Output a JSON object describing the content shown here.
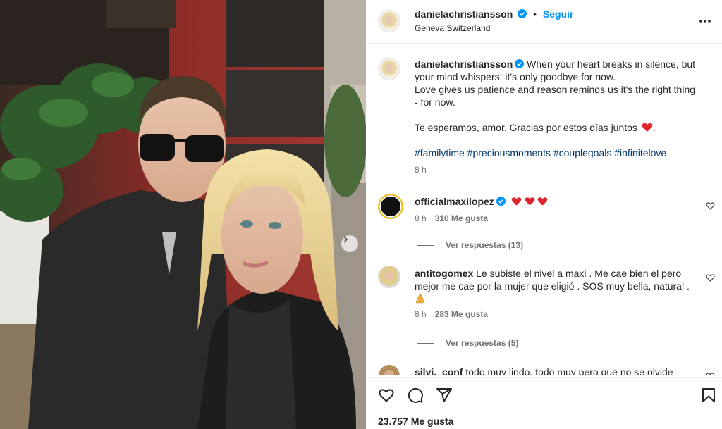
{
  "post": {
    "author": "danielachristiansson",
    "follow_label": "Seguir",
    "dot": "•",
    "location": "Geneva Switzerland",
    "caption_lines": [
      "When your heart breaks in silence, but",
      "your mind whispers: it's only goodbye for now.",
      "Love gives us patience and reason reminds us it's the right thing",
      "- for now.",
      "Te esperamos, amor. Gracias por estos días juntos",
      "."
    ],
    "hashtags": "#familytime #preciousmoments #couplegoals #infinitelove",
    "time": "8 h",
    "likes": "23.757 Me gusta"
  },
  "comments": [
    {
      "user": "officialmaxilopez",
      "text": "",
      "time": "8 h",
      "likes": "310 Me gusta",
      "replies": "Ver respuestas (13)"
    },
    {
      "user": "antitogomex",
      "text_line1": "Le subiste el nivel a maxi . Me cae bien el pero",
      "text_line2": "mejor me cae por la mujer que eligió . SOS muy bella, natural .",
      "time": "8 h",
      "likes": "283 Me gusta",
      "replies": "Ver respuestas (5)"
    },
    {
      "user": "silvi._conf",
      "text": "todo muy lindo, todo muy pero que no se olvide"
    }
  ],
  "icons": {
    "verified": "verified-badge-icon",
    "more": "more-options-icon",
    "heart": "heart-outline-icon",
    "comment": "comment-icon",
    "share": "share-icon",
    "save": "bookmark-icon",
    "next": "chevron-right-icon"
  },
  "colors": {
    "link": "#0095f6",
    "hashtag": "#00376b",
    "verified": "#0095f6",
    "red_heart": "#e0242d",
    "meta": "#737373"
  }
}
